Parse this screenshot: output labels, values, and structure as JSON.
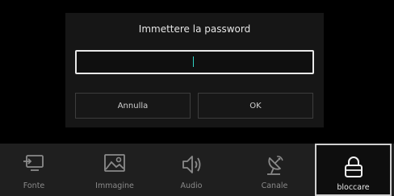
{
  "header_fragment": "…",
  "dialog": {
    "title": "Immettere la password",
    "password_value": "",
    "cancel_label": "Annulla",
    "ok_label": "OK"
  },
  "bottom_nav": {
    "items": [
      {
        "label": "Fonte",
        "icon": "source-input-icon"
      },
      {
        "label": "Immagine",
        "icon": "image-icon"
      },
      {
        "label": "Audio",
        "icon": "speaker-icon"
      },
      {
        "label": "Canale",
        "icon": "satellite-dish-icon"
      },
      {
        "label": "bloccare",
        "icon": "lock-icon",
        "selected": true
      }
    ]
  },
  "colors": {
    "background": "#000000",
    "dialog": "#161616",
    "caret": "#2fd3c4",
    "nav_bar": "#1f1f1f"
  }
}
